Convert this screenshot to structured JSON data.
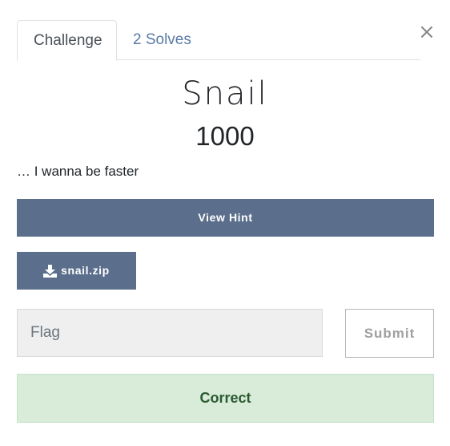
{
  "tabs": {
    "challenge_label": "Challenge",
    "solves_label": "2 Solves"
  },
  "close_icon": "close-icon",
  "challenge": {
    "name": "Snail",
    "points": "1000",
    "description": "… I wanna be faster"
  },
  "hint": {
    "label": "View Hint"
  },
  "file": {
    "icon": "download-icon",
    "name": "snail.zip"
  },
  "flag": {
    "placeholder": "Flag",
    "value": ""
  },
  "submit": {
    "label": "Submit"
  },
  "result": {
    "message": "Correct"
  },
  "colors": {
    "button": "#5b6f8c",
    "tab_link": "#5a7aa6",
    "success_bg": "#d9ecda",
    "success_text": "#2b5a31"
  }
}
